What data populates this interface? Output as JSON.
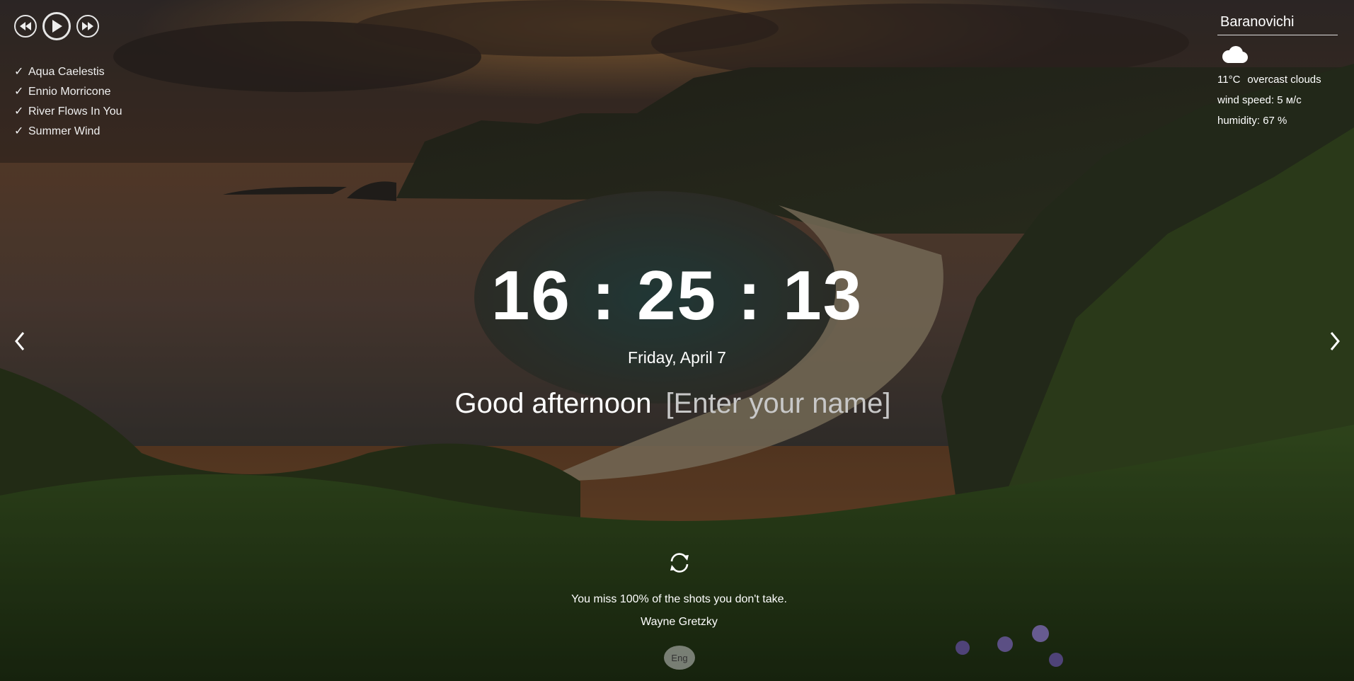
{
  "player": {
    "buttons": [
      {
        "name": "play-prev-button",
        "icon": "rewind-icon"
      },
      {
        "name": "play-button",
        "icon": "play-icon"
      },
      {
        "name": "play-next-button",
        "icon": "fast-forward-icon"
      }
    ],
    "playlist": [
      {
        "check": "✓",
        "title": "Aqua Caelestis"
      },
      {
        "check": "✓",
        "title": "Ennio Morricone"
      },
      {
        "check": "✓",
        "title": "River Flows In You"
      },
      {
        "check": "✓",
        "title": "Summer Wind"
      }
    ]
  },
  "weather": {
    "city": "Baranovichi",
    "icon": "cloud-icon",
    "temperature": "11°C",
    "description": "overcast clouds",
    "wind": "wind speed: 5 м/с",
    "humidity": "humidity: 67 %"
  },
  "slider": {
    "prev_icon": "chevron-left-icon",
    "next_icon": "chevron-right-icon"
  },
  "clock": {
    "time": "16 : 25 : 13",
    "date": "Friday, April 7"
  },
  "greeting": {
    "text": "Good afternoon",
    "name_placeholder": "[Enter your name]",
    "name_value": ""
  },
  "quote": {
    "refresh_icon": "refresh-icon",
    "text": "You miss 100% of the shots you don't take.",
    "author": "Wayne Gretzky"
  },
  "language": {
    "label": "Eng"
  },
  "colors": {
    "text": "#ffffff",
    "placeholder": "#c8c8c8",
    "lang_button": "#c8c8c8"
  }
}
